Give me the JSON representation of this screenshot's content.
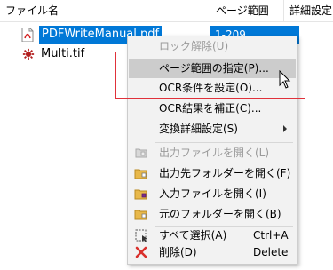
{
  "columns": {
    "filename": "ファイル名",
    "page_range": "ページ範囲",
    "detail": "詳細設定"
  },
  "files": [
    {
      "name": "PDFWriteManual.pdf",
      "range": "1-209",
      "selected": true,
      "icon": "pdf-file-icon"
    },
    {
      "name": "Multi.tif",
      "range": "",
      "selected": false,
      "icon": "tif-file-icon"
    }
  ],
  "menu": {
    "items": [
      {
        "label": "ロック解除(U)",
        "disabled": true,
        "icon": ""
      },
      {
        "label": "ページ範囲の指定(P)...",
        "disabled": false,
        "hover": true,
        "icon": ""
      },
      {
        "label": "OCR条件を設定(O)...",
        "disabled": false,
        "icon": ""
      },
      {
        "label": "OCR結果を補正(C)...",
        "disabled": false,
        "icon": ""
      },
      {
        "label": "変換詳細設定(S)",
        "disabled": false,
        "submenu": true,
        "icon": ""
      },
      {
        "label": "出力ファイルを開く(L)",
        "disabled": true,
        "icon": "open-output-file-icon"
      },
      {
        "label": "出力先フォルダーを開く(F)",
        "disabled": false,
        "icon": "open-output-folder-icon"
      },
      {
        "label": "入力ファイルを開く(I)",
        "disabled": false,
        "icon": "open-input-file-icon"
      },
      {
        "label": "元のフォルダーを開く(B)",
        "disabled": false,
        "icon": "open-source-folder-icon"
      },
      {
        "label": "すべて選択(A)",
        "accel": "Ctrl+A",
        "disabled": false,
        "icon": "select-all-icon"
      },
      {
        "label": "削除(D)",
        "accel": "Delete",
        "disabled": false,
        "icon": "delete-icon"
      }
    ]
  },
  "colors": {
    "selection": "#0078d7",
    "menu_bg": "#f2f2f2",
    "highlight_box": "#e0313a",
    "delete_icon": "#d9302c"
  }
}
